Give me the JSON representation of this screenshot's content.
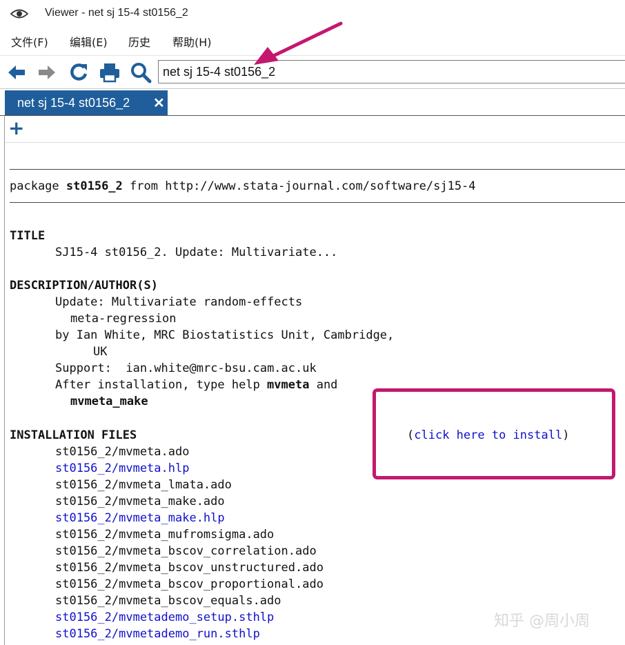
{
  "window": {
    "title": "Viewer - net sj 15-4 st0156_2",
    "icon": "eye-icon"
  },
  "menu": {
    "file": "文件(F)",
    "edit": "编辑(E)",
    "history": "历史",
    "help": "帮助(H)"
  },
  "toolbar": {
    "icons": [
      "back-arrow-icon",
      "forward-arrow-icon",
      "refresh-icon",
      "print-icon",
      "search-icon"
    ],
    "address_value": "net sj 15-4 st0156_2"
  },
  "tabs": [
    {
      "label": "net sj 15-4 st0156_2",
      "close": "✕"
    }
  ],
  "new_tab_label": "+",
  "document": {
    "package_prefix": "package ",
    "package_name": "st0156_2",
    "package_suffix": " from http://www.stata-journal.com/software/sj15-4",
    "title_heading": "TITLE",
    "title_text": "SJ15-4 st0156_2. Update: Multivariate...",
    "desc_heading": "DESCRIPTION/AUTHOR(S)",
    "desc_line1": "Update: Multivariate random-effects",
    "desc_line2": "meta-regression",
    "desc_line3": "by Ian White, MRC Biostatistics Unit, Cambridge,",
    "desc_line4": "UK",
    "support_label": "Support:",
    "support_email": "ian.white@mrc-bsu.cam.ac.uk",
    "after_install_text": "After installation, type help ",
    "after_install_cmd1": "mvmeta",
    "after_install_and": " and",
    "after_install_cmd2": "mvmeta_make",
    "install_heading": "INSTALLATION FILES",
    "install_link_open": "(",
    "install_link": "click here to install",
    "install_link_close": ")",
    "files": [
      {
        "name": "st0156_2/mvmeta.ado",
        "link": false
      },
      {
        "name": "st0156_2/mvmeta.hlp",
        "link": true
      },
      {
        "name": "st0156_2/mvmeta_lmata.ado",
        "link": false
      },
      {
        "name": "st0156_2/mvmeta_make.ado",
        "link": false
      },
      {
        "name": "st0156_2/mvmeta_make.hlp",
        "link": true
      },
      {
        "name": "st0156_2/mvmeta_mufromsigma.ado",
        "link": false
      },
      {
        "name": "st0156_2/mvmeta_bscov_correlation.ado",
        "link": false
      },
      {
        "name": "st0156_2/mvmeta_bscov_unstructured.ado",
        "link": false
      },
      {
        "name": "st0156_2/mvmeta_bscov_proportional.ado",
        "link": false
      },
      {
        "name": "st0156_2/mvmeta_bscov_equals.ado",
        "link": false
      },
      {
        "name": "st0156_2/mvmetademo_setup.sthlp",
        "link": true
      },
      {
        "name": "st0156_2/mvmetademo_run.sthlp",
        "link": true
      }
    ]
  },
  "annotation": {
    "arrow_color": "#c4186f",
    "box_color": "#c4186f"
  },
  "watermark": "知乎 @周小周",
  "colors": {
    "tab_active": "#1f5e9b",
    "toolbar_icon": "#1f5e9b",
    "link": "#1010cc"
  }
}
